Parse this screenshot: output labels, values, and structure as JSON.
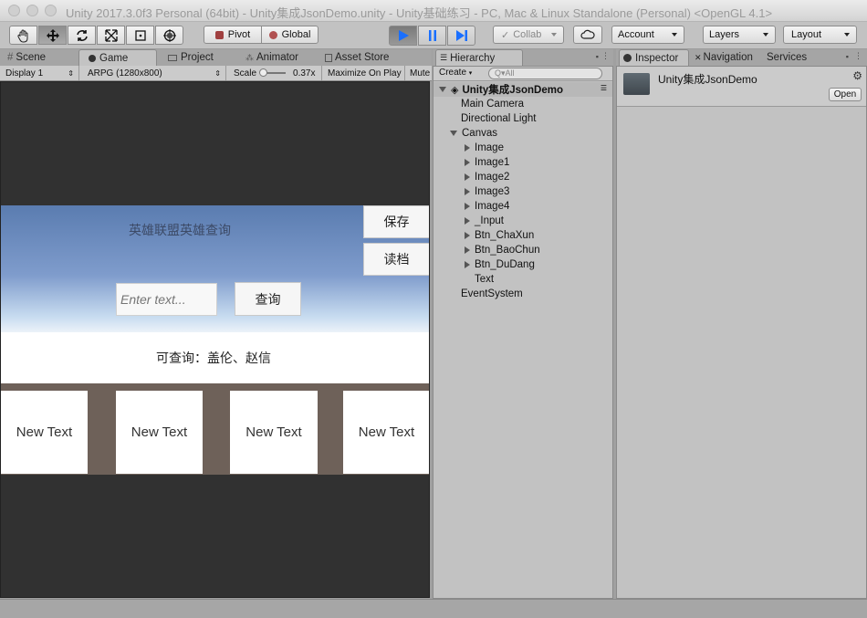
{
  "window": {
    "title": "Unity 2017.3.0f3 Personal (64bit) - Unity集成JsonDemo.unity - Unity基础练习 - PC, Mac & Linux Standalone (Personal) <OpenGL 4.1>"
  },
  "toolbar": {
    "tools": [
      "hand-tool",
      "move-tool",
      "rotate-tool",
      "scale-tool",
      "rect-tool",
      "transform-tool"
    ],
    "pivot_label": "Pivot",
    "global_label": "Global",
    "collab_label": "Collab",
    "account_label": "Account",
    "layers_label": "Layers",
    "layout_label": "Layout"
  },
  "left_tabs": {
    "scene": "Scene",
    "game": "Game",
    "project": "Project",
    "animator": "Animator",
    "asset_store": "Asset Store"
  },
  "game_bar": {
    "display": "Display 1",
    "resolution": "ARPG (1280x800)",
    "scale_label": "Scale",
    "scale_value": "0.37x",
    "maximize": "Maximize On Play",
    "mute": "Mute"
  },
  "game": {
    "title": "英雄联盟英雄查询",
    "save_button": "保存",
    "load_button": "读档",
    "input_placeholder": "Enter text...",
    "query_button": "查询",
    "hint": "可查询：盖伦、赵信",
    "cards": [
      "New Text",
      "New Text",
      "New Text",
      "New Text"
    ]
  },
  "hierarchy": {
    "tab": "Hierarchy",
    "create": "Create",
    "search_placeholder": "Q▾All",
    "scene": "Unity集成JsonDemo",
    "items": [
      {
        "label": "Main Camera",
        "indent": 0,
        "arrow": "none"
      },
      {
        "label": "Directional Light",
        "indent": 0,
        "arrow": "none"
      },
      {
        "label": "Canvas",
        "indent": 0,
        "arrow": "down"
      },
      {
        "label": "Image",
        "indent": 1,
        "arrow": "right"
      },
      {
        "label": "Image1",
        "indent": 1,
        "arrow": "right"
      },
      {
        "label": "Image2",
        "indent": 1,
        "arrow": "right"
      },
      {
        "label": "Image3",
        "indent": 1,
        "arrow": "right"
      },
      {
        "label": "Image4",
        "indent": 1,
        "arrow": "right"
      },
      {
        "label": "_Input",
        "indent": 1,
        "arrow": "right"
      },
      {
        "label": "Btn_ChaXun",
        "indent": 1,
        "arrow": "right"
      },
      {
        "label": "Btn_BaoChun",
        "indent": 1,
        "arrow": "right"
      },
      {
        "label": "Btn_DuDang",
        "indent": 1,
        "arrow": "right"
      },
      {
        "label": "Text",
        "indent": 1,
        "arrow": "none"
      },
      {
        "label": "EventSystem",
        "indent": 0,
        "arrow": "none"
      }
    ]
  },
  "inspector": {
    "tab": "Inspector",
    "navigation_tab": "Navigation",
    "services_tab": "Services",
    "object_name": "Unity集成JsonDemo",
    "open_button": "Open"
  }
}
